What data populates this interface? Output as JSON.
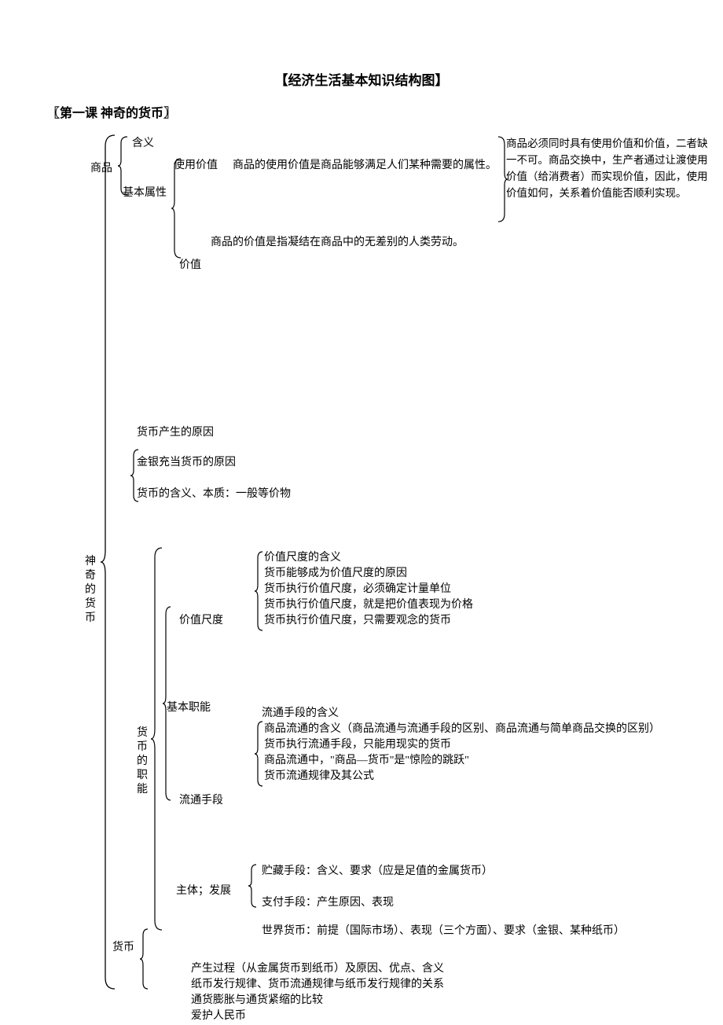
{
  "title": "【经济生活基本知识结构图】",
  "subtitle": "〖第一课  神奇的货币〗",
  "root_label": "神\n奇\n的\n货\n币",
  "nodes": {
    "shangpin": "商品",
    "hanyi": "含义",
    "jiben_shuxing": "基本属性",
    "shiyong_jiazhi": "使用价值",
    "shiyong_jiazhi_desc": "商品的使用价值是商品能够满足人们某种需要的属性。",
    "jiazhi": "价值",
    "jiazhi_desc": "商品的价值是指凝结在商品中的无差别的人类劳动。",
    "note_right": "商品必须同时具有使用价值和价值，二者缺一不可。商品交换中，生产者通过让渡使用价值（给消费者）而实现价值，因此，使用价值如何，关系着价值能否顺利实现。",
    "huobi_chansheng": "货币产生的原因",
    "jinyin_chongdang": "金银充当货币的原因",
    "huobi_hanyi_benzhi": "货币的含义、本质：一般等价物",
    "huobi_de_zhineng": "货\n币\n的\n职\n能",
    "jiben_zhineng": "基本职能",
    "jiazhi_chidu": "价值尺度",
    "jcd_items": [
      "价值尺度的含义",
      "货币能够成为价值尺度的原因",
      "货币执行价值尺度，必须确定计量单位",
      "货币执行价值尺度，就是把价值表现为价格",
      "货币执行价值尺度，只需要观念的货币"
    ],
    "liutong_shouduan": "流通手段",
    "lts_hanyi": "流通手段的含义",
    "lts_items": [
      "商品流通的含义（商品流通与流通手段的区别、商品流通与简单商品交换的区别）",
      "货币执行流通手段，只能用现实的货币",
      "商品流通中，\"商品—货币\"是\"惊险的跳跃\"",
      "货币流通规律及其公式"
    ],
    "zhuti_fazhan": "主体；发展",
    "zhucang": "贮藏手段：含义、要求（应是足值的金属货币）",
    "zhifu": "支付手段：产生原因、表现",
    "shijie_huobi": "世界货币：前提（国际市场）、表现（三个方面）、要求（金银、某种纸币）",
    "huobi_label": "货币",
    "bottom_items": [
      "产生过程（从金属货币到纸币）及原因、优点、含义",
      "纸币发行规律、货币流通规律与纸币发行规律的关系",
      "通货膨胀与通货紧缩的比较",
      "爱护人民币"
    ]
  }
}
